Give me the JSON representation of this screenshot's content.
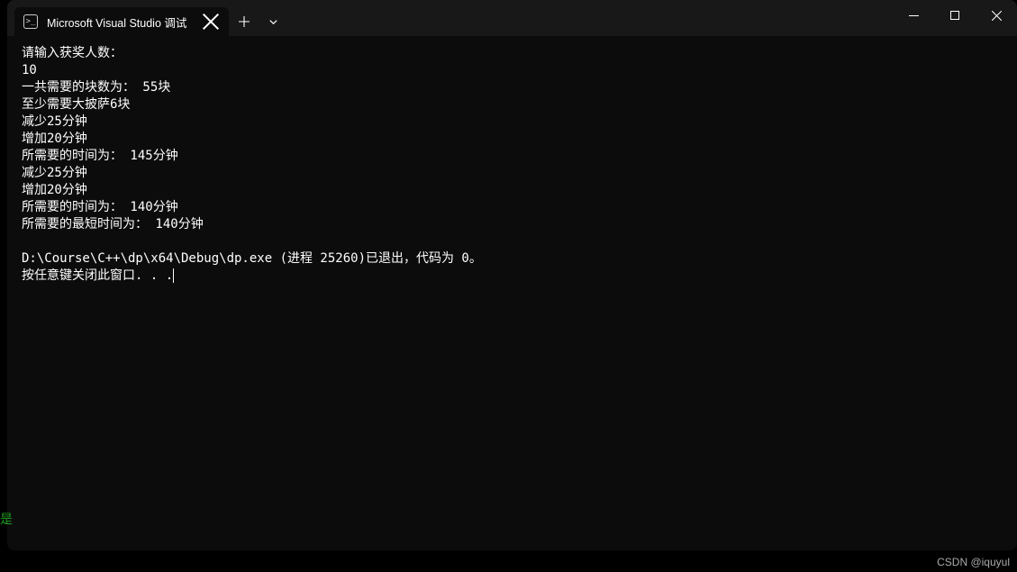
{
  "titlebar": {
    "tab_title": "Microsoft Visual Studio 调试",
    "tab_icon_glyph": ">_"
  },
  "console": {
    "lines": [
      "请输入获奖人数：",
      "10",
      "一共需要的块数为： 55块",
      "至少需要大披萨6块",
      "减少25分钟",
      "增加20分钟",
      "所需要的时间为： 145分钟",
      "减少25分钟",
      "增加20分钟",
      "所需要的时间为： 140分钟",
      "所需要的最短时间为： 140分钟",
      "",
      "D:\\Course\\C++\\dp\\x64\\Debug\\dp.exe (进程 25260)已退出，代码为 0。",
      "按任意键关闭此窗口. . ."
    ]
  },
  "side_char": "是",
  "watermark": "CSDN @iquyul"
}
